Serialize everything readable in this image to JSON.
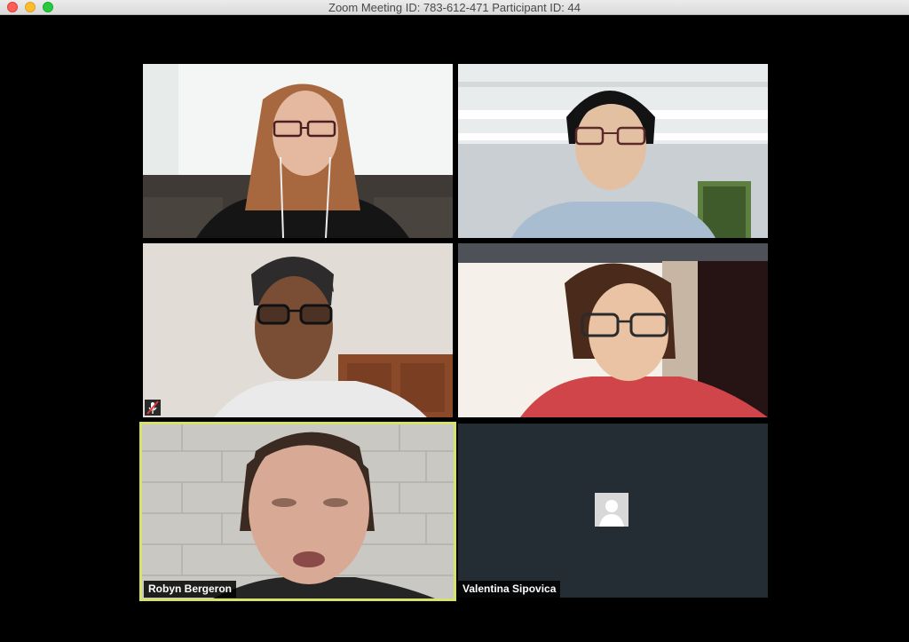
{
  "window": {
    "title": "Zoom Meeting ID: 783-612-471  Participant ID: 44"
  },
  "participants": [
    {
      "name": "",
      "muted": false
    },
    {
      "name": "",
      "muted": false
    },
    {
      "name": "",
      "muted": true
    },
    {
      "name": "",
      "muted": false
    },
    {
      "name": "Robyn Bergeron",
      "muted": false,
      "active_speaker": true
    },
    {
      "name": "Valentina Sipovica",
      "muted": false,
      "video_off": true
    }
  ],
  "colors": {
    "active_speaker_border": "#d6e26a",
    "video_off_background": "#242d34",
    "muted_icon": "#e53935"
  }
}
